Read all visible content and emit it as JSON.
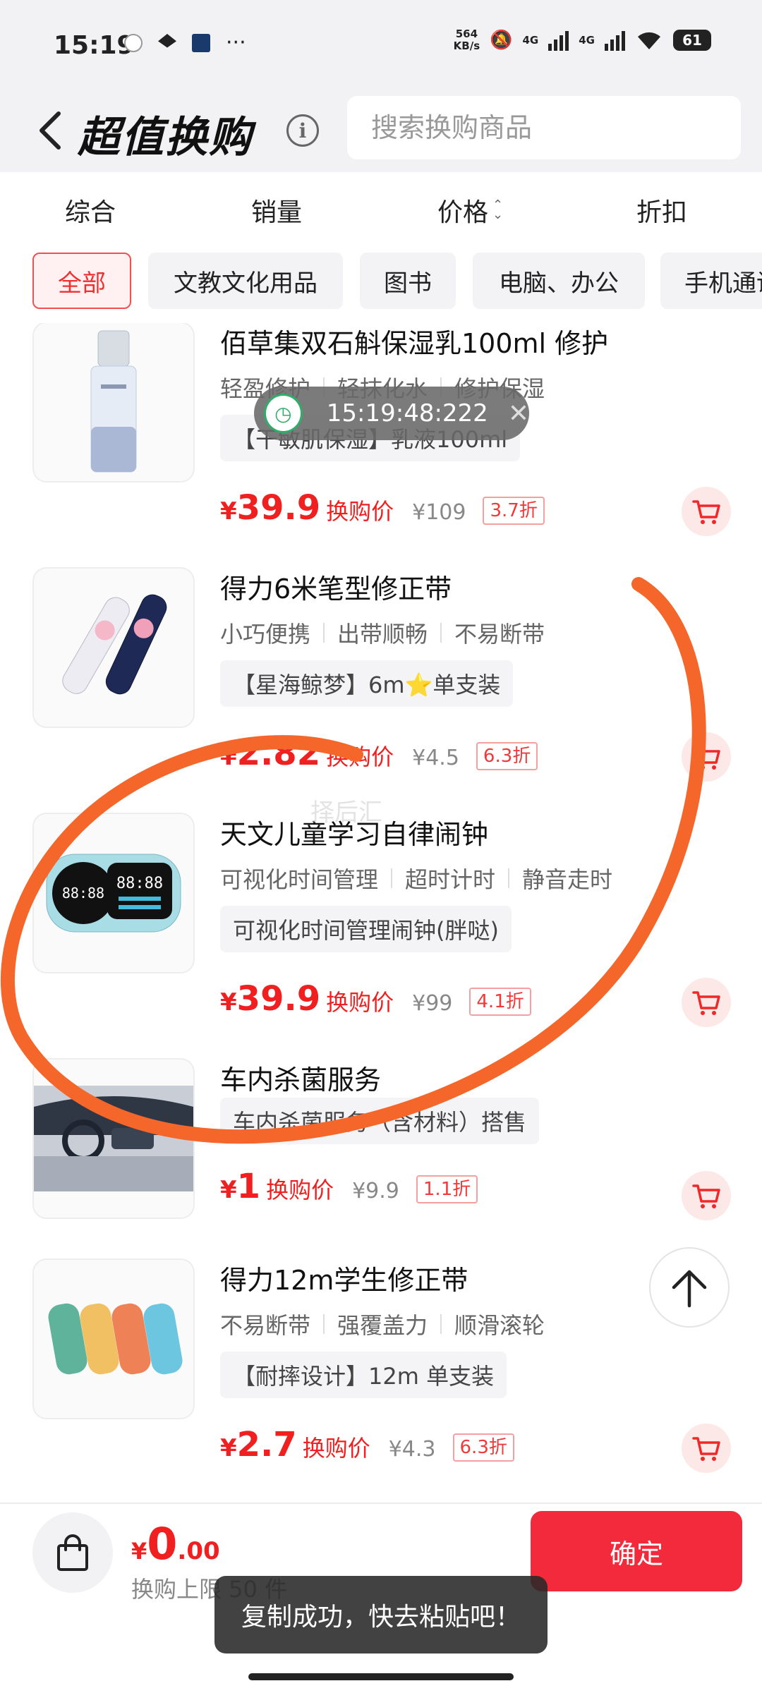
{
  "status_bar": {
    "time": "15:19",
    "net_speed_value": "564",
    "net_speed_unit": "KB/s",
    "network_1": "4G",
    "network_2": "4G",
    "battery": "61",
    "more": "···"
  },
  "header": {
    "title": "超值换购",
    "search_placeholder": "搜索换购商品"
  },
  "sort_tabs": [
    "综合",
    "销量",
    "价格",
    "折扣"
  ],
  "categories": [
    "全部",
    "文教文化用品",
    "图书",
    "电脑、办公",
    "手机通讯"
  ],
  "products": [
    {
      "title": "佰草集双石斛保湿乳100ml 修护",
      "tags": [
        "轻盈修护",
        "轻抹化水",
        "修护保湿"
      ],
      "spec": "【干敏肌保湿】乳液100ml",
      "price": "39.9",
      "swap_label": "换购价",
      "original_price": "¥109",
      "discount": "3.7折"
    },
    {
      "title": "得力6米笔型修正带",
      "tags": [
        "小巧便携",
        "出带顺畅",
        "不易断带"
      ],
      "spec": "【星海鲸梦】6m⭐单支装",
      "price": "2.82",
      "swap_label": "换购价",
      "original_price": "¥4.5",
      "discount": "6.3折"
    },
    {
      "title": "天文儿童学习自律闹钟",
      "tags": [
        "可视化时间管理",
        "超时计时",
        "静音走时"
      ],
      "spec": "可视化时间管理闹钟(胖哒)",
      "price": "39.9",
      "swap_label": "换购价",
      "original_price": "¥99",
      "discount": "4.1折"
    },
    {
      "title": "车内杀菌服务",
      "tags": [],
      "spec": "车内杀菌服务（含材料）搭售",
      "price": "1",
      "swap_label": "换购价",
      "original_price": "¥9.9",
      "discount": "1.1折"
    },
    {
      "title": "得力12m学生修正带",
      "tags": [
        "不易断带",
        "强覆盖力",
        "顺滑滚轮"
      ],
      "spec": "【耐摔设计】12m 单支装",
      "price": "2.7",
      "swap_label": "换购价",
      "original_price": "¥4.3",
      "discount": "6.3折"
    }
  ],
  "timer_overlay": {
    "time": "15:19:48:222",
    "close": "✕"
  },
  "watermark": "择后汇",
  "bottom_bar": {
    "currency": "¥",
    "total_int": "0",
    "total_dec": ".00",
    "limit": "换购上限 50 件",
    "confirm": "确定"
  },
  "toast": "复制成功，快去粘贴吧！",
  "colors": {
    "accent": "#f02020",
    "confirm_button": "#f22a3b",
    "scribble": "#f4662a"
  },
  "icons": {
    "back": "chevron-left-icon",
    "info": "info-icon",
    "cart": "cart-icon",
    "scroll_top": "arrow-up-icon",
    "bag": "shopping-bag-icon"
  }
}
